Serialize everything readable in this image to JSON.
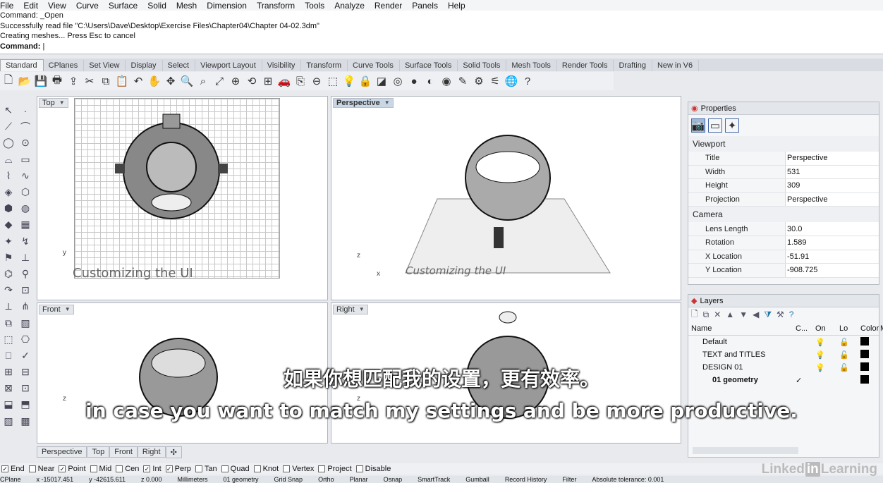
{
  "menu": [
    "File",
    "Edit",
    "View",
    "Curve",
    "Surface",
    "Solid",
    "Mesh",
    "Dimension",
    "Transform",
    "Tools",
    "Analyze",
    "Render",
    "Panels",
    "Help"
  ],
  "command_history": [
    "Command: _Open",
    "Successfully read file \"C:\\Users\\Dave\\Desktop\\Exercise Files\\Chapter04\\Chapter 04-02.3dm\"",
    "Creating meshes... Press Esc to cancel"
  ],
  "command_prompt": "Command:",
  "toolbar_tabs": [
    "Standard",
    "CPlanes",
    "Set View",
    "Display",
    "Select",
    "Viewport Layout",
    "Visibility",
    "Transform",
    "Curve Tools",
    "Surface Tools",
    "Solid Tools",
    "Mesh Tools",
    "Render Tools",
    "Drafting",
    "New in V6"
  ],
  "toolbar_icons": [
    "new-icon",
    "open-icon",
    "save-icon",
    "print-icon",
    "import-icon",
    "cut-icon",
    "copy-icon",
    "paste-icon",
    "undo-icon",
    "pan-icon",
    "move-icon",
    "zoom-icon",
    "zoom-window-icon",
    "zoom-extents-icon",
    "zoom-selected-icon",
    "rotate-view-icon",
    "four-viewports-icon",
    "car-icon",
    "copy-properties-icon",
    "properties-icon",
    "select-icon",
    "light-icon",
    "lock-icon",
    "materials-icon",
    "color-wheel-icon",
    "sphere-icon",
    "sphere-shaded-icon",
    "sphere-render-icon",
    "pencil-icon",
    "gear-icon",
    "options-icon",
    "globe-icon",
    "help-icon"
  ],
  "viewports": {
    "top": "Top",
    "perspective": "Perspective",
    "front": "Front",
    "right": "Right",
    "watermark": "Customizing the UI",
    "axes": {
      "x": "x",
      "y": "y",
      "z": "z"
    }
  },
  "viewport_tabs": [
    "Perspective",
    "Top",
    "Front",
    "Right"
  ],
  "properties": {
    "title": "Properties",
    "section_viewport": "Viewport",
    "viewport_rows": [
      {
        "k": "Title",
        "v": "Perspective"
      },
      {
        "k": "Width",
        "v": "531"
      },
      {
        "k": "Height",
        "v": "309"
      },
      {
        "k": "Projection",
        "v": "Perspective"
      }
    ],
    "section_camera": "Camera",
    "camera_rows": [
      {
        "k": "Lens Length",
        "v": "30.0"
      },
      {
        "k": "Rotation",
        "v": "1.589"
      },
      {
        "k": "X Location",
        "v": "-51.91"
      },
      {
        "k": "Y Location",
        "v": "-908.725"
      }
    ]
  },
  "layers": {
    "title": "Layers",
    "headers": [
      "Name",
      "C...",
      "On",
      "Lo",
      "Color",
      "M"
    ],
    "rows": [
      {
        "name": "Default",
        "check": ""
      },
      {
        "name": "TEXT and TITLES",
        "check": ""
      },
      {
        "name": "DESIGN 01",
        "check": ""
      },
      {
        "name": "01 geometry",
        "check": "✓"
      }
    ]
  },
  "osnaps": [
    {
      "label": "End",
      "checked": true
    },
    {
      "label": "Near",
      "checked": false
    },
    {
      "label": "Point",
      "checked": true
    },
    {
      "label": "Mid",
      "checked": false
    },
    {
      "label": "Cen",
      "checked": false
    },
    {
      "label": "Int",
      "checked": true
    },
    {
      "label": "Perp",
      "checked": true
    },
    {
      "label": "Tan",
      "checked": false
    },
    {
      "label": "Quad",
      "checked": false
    },
    {
      "label": "Knot",
      "checked": false
    },
    {
      "label": "Vertex",
      "checked": false
    },
    {
      "label": "Project",
      "checked": false
    },
    {
      "label": "Disable",
      "checked": false
    }
  ],
  "status_items": [
    "CPlane",
    "x -15017.451",
    "y -42615.611",
    "z 0.000",
    "Millimeters",
    "01 geometry",
    "Grid Snap",
    "Ortho",
    "Planar",
    "Osnap",
    "SmartTrack",
    "Gumball",
    "Record History",
    "Filter",
    "Absolute tolerance: 0.001"
  ],
  "subtitles": {
    "cn": "如果你想匹配我的设置，更有效率。",
    "en": "in case you want to match my settings and be more productive."
  },
  "brand": {
    "pre": "Linked",
    "in": "in",
    "post": "Learning"
  }
}
